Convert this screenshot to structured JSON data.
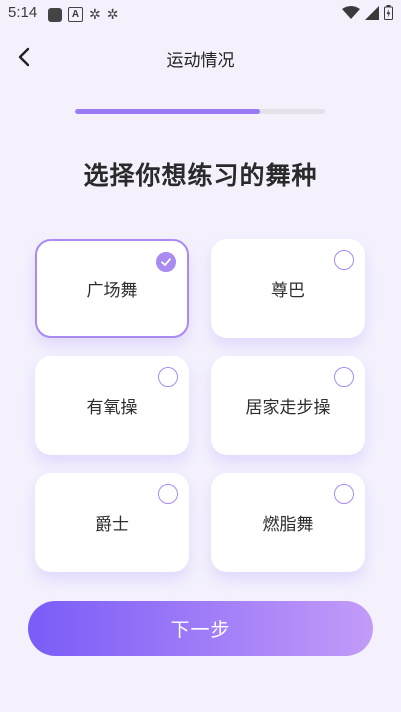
{
  "status_bar": {
    "time": "5:14"
  },
  "nav": {
    "title": "运动情况"
  },
  "progress": {
    "value_percent": 74,
    "accent": "#9a7af5"
  },
  "headline": "选择你想练习的舞种",
  "options": [
    {
      "label": "广场舞",
      "selected": true
    },
    {
      "label": "尊巴",
      "selected": false
    },
    {
      "label": "有氧操",
      "selected": false
    },
    {
      "label": "居家走步操",
      "selected": false
    },
    {
      "label": "爵士",
      "selected": false
    },
    {
      "label": "燃脂舞",
      "selected": false
    }
  ],
  "next_button": {
    "label": "下一步"
  },
  "colors": {
    "accent": "#a98bf2",
    "button_start": "#7a5cf7",
    "button_end": "#c39bf8",
    "background": "#f4f1fd"
  }
}
